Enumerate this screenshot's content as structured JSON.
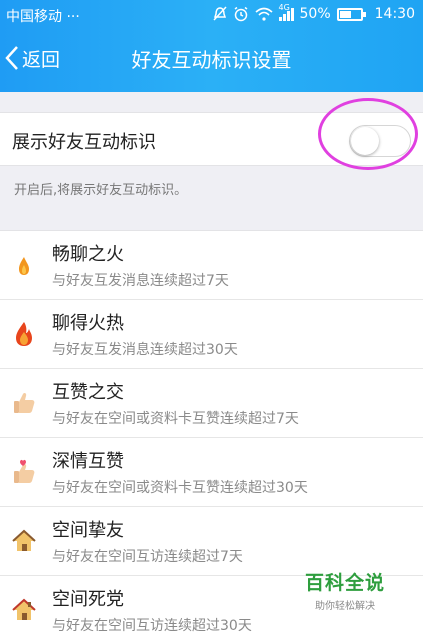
{
  "status_bar": {
    "carrier": "中国移动 ···",
    "network": "4G",
    "battery": "50%",
    "time": "14:30"
  },
  "nav": {
    "back_label": "返回",
    "title": "好友互动标识设置"
  },
  "toggle": {
    "label": "展示好友互动标识",
    "on": false
  },
  "hint": "开启后,将展示好友互动标识。",
  "items": [
    {
      "title": "畅聊之火",
      "desc": "与好友互发消息连续超过7天",
      "icon": "small-flame-icon"
    },
    {
      "title": "聊得火热",
      "desc": "与好友互发消息连续超过30天",
      "icon": "big-flame-icon"
    },
    {
      "title": "互赞之交",
      "desc": "与好友在空间或资料卡互赞连续超过7天",
      "icon": "thumbs-up-icon"
    },
    {
      "title": "深情互赞",
      "desc": "与好友在空间或资料卡互赞连续超过30天",
      "icon": "heart-thumbs-up-icon"
    },
    {
      "title": "空间挚友",
      "desc": "与好友在空间互访连续超过7天",
      "icon": "small-house-icon"
    },
    {
      "title": "空间死党",
      "desc": "与好友在空间互访连续超过30天",
      "icon": "house-icon"
    }
  ],
  "watermark": {
    "main": "百科全说",
    "sub": "助你轻松解决"
  },
  "colors": {
    "header": "#1f9cf4",
    "highlight": "#e040e0",
    "watermark": "#2e9e3e"
  }
}
